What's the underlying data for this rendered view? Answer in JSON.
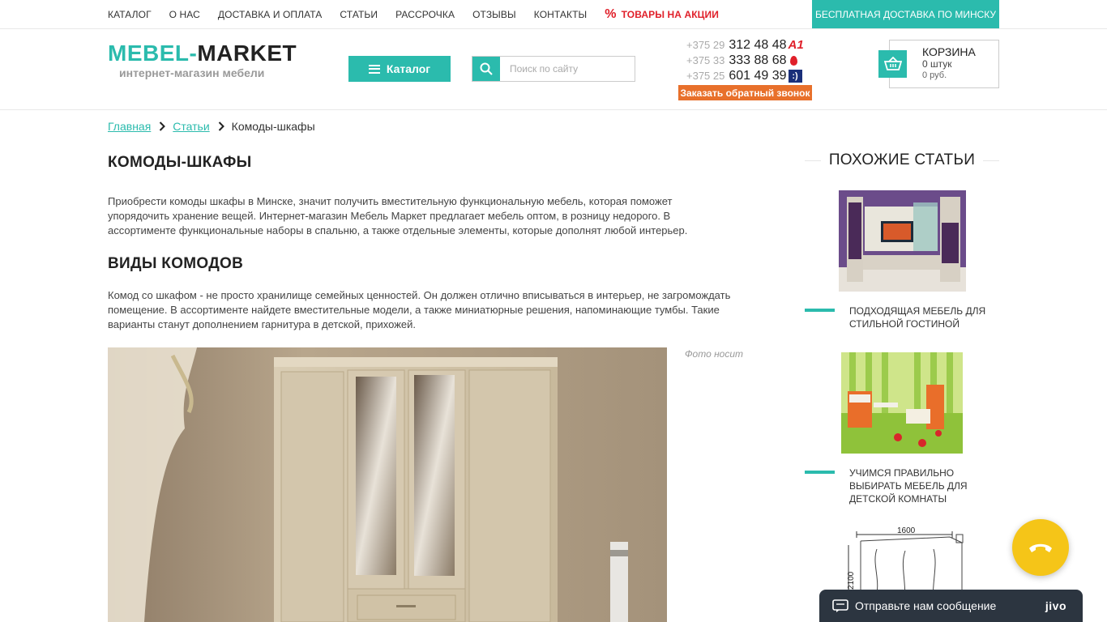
{
  "topnav": {
    "items": [
      "КАТАЛОГ",
      "О НАС",
      "ДОСТАВКА И ОПЛАТА",
      "СТАТЬИ",
      "РАССРОЧКА",
      "ОТЗЫВЫ",
      "КОНТАКТЫ"
    ],
    "promo_icon": "%",
    "promo_label": "ТОВАРЫ НА АКЦИИ",
    "free_delivery": "БЕСПЛАТНАЯ ДОСТАВКА ПО МИНСКУ"
  },
  "header": {
    "logo_part1": "MEBEL-",
    "logo_part2": "MARKET",
    "tagline": "интернет-магазин мебели",
    "catalog_button": "Каталог",
    "search_placeholder": "Поиск по сайту",
    "phones": [
      {
        "prefix": "+375 29",
        "number": "312 48 48",
        "operator_label": "A1"
      },
      {
        "prefix": "+375 33",
        "number": "333 88 68",
        "operator_label": ""
      },
      {
        "prefix": "+375 25",
        "number": "601 49 39",
        "operator_label": ":)"
      }
    ],
    "callback_button": "Заказать обратный звонок",
    "cart": {
      "title": "КОРЗИНА",
      "count": "0 штук",
      "sum": "0 руб."
    }
  },
  "breadcrumb": {
    "home": "Главная",
    "section": "Статьи",
    "current": "Комоды-шкафы"
  },
  "article": {
    "title": "КОМОДЫ-ШКАФЫ",
    "intro": "Приобрести комоды шкафы в Минске, значит получить вместительную функциональную мебель, которая поможет упорядочить хранение вещей. Интернет-магазин Мебель Маркет предлагает мебель оптом, в розницу недорого. В ассортименте функциональные наборы в спальню, а также отдельные элементы, которые дополнят любой интерьер.",
    "subtitle": "ВИДЫ КОМОДОВ",
    "body": "Комод со шкафом - не просто хранилище семейных ценностей. Он должен отлично вписываться в интерьер, не загромождать помещение. В ассортименте найдете вместительные модели, а также миниатюрные решения, напоминающие тумбы. Такие варианты станут дополнением гарнитура в детской, прихожей.",
    "photo_caption": "Фото носит"
  },
  "sidebar": {
    "title": "ПОХОЖИЕ СТАТЬИ",
    "articles": [
      {
        "title": "ПОДХОДЯЩАЯ МЕБЕЛЬ ДЛЯ СТИЛЬНОЙ ГОСТИНОЙ"
      },
      {
        "title": "УЧИМСЯ ПРАВИЛЬНО ВЫБИРАТЬ МЕБЕЛЬ ДЛЯ ДЕТСКОЙ КОМНАТЫ"
      }
    ],
    "drawing_width": "1600",
    "drawing_height": "2100"
  },
  "chat": {
    "label": "Отправьте нам сообщение",
    "brand": "jivo"
  },
  "colors": {
    "accent": "#2bbbad",
    "promo": "#e0202a",
    "callback": "#e8702b",
    "call_fab": "#f5c518",
    "chat_bg": "#2c3540"
  }
}
